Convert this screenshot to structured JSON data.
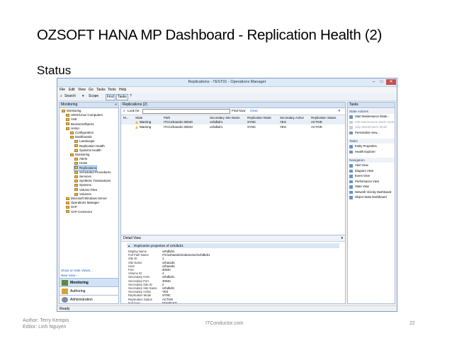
{
  "slide": {
    "title": "OZSOFT HANA MP Dashboard - Replication Health (2)",
    "subtitle": "Status",
    "footer_left_1": "Author: Terry Kempis",
    "footer_left_2": "Editor: Linh Nguyen",
    "footer_center": "ITConductor.com",
    "footer_right": "22"
  },
  "window": {
    "title": "Replications - TEST01 - Operations Manager",
    "min": "–",
    "max": "□",
    "close": "✕",
    "menu": [
      "File",
      "Edit",
      "View",
      "Go",
      "Tasks",
      "Tools",
      "Help"
    ],
    "toolbar": {
      "search": "Search",
      "scope": "Scope",
      "find": "Find",
      "tasks": "Tasks",
      "help": "?"
    },
    "status_bar": "Ready"
  },
  "nav": {
    "header": "Monitoring",
    "tree": [
      {
        "label": "Monitoring",
        "indent": 0
      },
      {
        "label": "UNIX/Linux Computers",
        "indent": 1
      },
      {
        "label": "ASE",
        "indent": 1
      },
      {
        "label": "BusinessObjects",
        "indent": 1
      },
      {
        "label": "HANA",
        "indent": 1
      },
      {
        "label": "Configuration",
        "indent": 2
      },
      {
        "label": "Dashboards",
        "indent": 2
      },
      {
        "label": "Landscape",
        "indent": 3
      },
      {
        "label": "Replication Health",
        "indent": 3
      },
      {
        "label": "Systems Health",
        "indent": 3
      },
      {
        "label": "Monitoring",
        "indent": 2
      },
      {
        "label": "Alerts",
        "indent": 3
      },
      {
        "label": "Hosts",
        "indent": 3
      },
      {
        "label": "Replications",
        "indent": 3,
        "selected": true
      },
      {
        "label": "Scheduled Procedures",
        "indent": 3
      },
      {
        "label": "Services",
        "indent": 3
      },
      {
        "label": "Synthetic Transactions",
        "indent": 3
      },
      {
        "label": "Systems",
        "indent": 3
      },
      {
        "label": "Volume Files",
        "indent": 3
      },
      {
        "label": "Volumes",
        "indent": 3
      },
      {
        "label": "Microsoft Windows Server",
        "indent": 1
      },
      {
        "label": "Operations Manager",
        "indent": 1
      },
      {
        "label": "SAP",
        "indent": 1
      },
      {
        "label": "SAP Connector",
        "indent": 1
      }
    ],
    "show_hide": "Show or Hide Views...",
    "new_view": "New View ›",
    "wunderbar": [
      "Monitoring",
      "Authoring",
      "Administration"
    ]
  },
  "center": {
    "header": "Replications (2)",
    "look_for": "Look for:",
    "find_now": "Find Now",
    "clear": "Clear",
    "columns": [
      "M...",
      "State",
      "Path",
      "Secondary Site Name",
      "Replication Mode",
      "Secondary Active",
      "Replication Status"
    ],
    "rows": [
      {
        "state": "Warning",
        "path": "ITC/ozhanalrc:30040",
        "site": "ozhdbdr1",
        "mode": "SYNC",
        "active": "YES",
        "status": "ACTIVE"
      },
      {
        "state": "Warning",
        "path": "ITC/ozhanalrc:30043",
        "site": "ozhdbdr1",
        "mode": "SYNC",
        "active": "YES",
        "status": "ACTIVE"
      }
    ],
    "detail_header": "Detail View",
    "detail_title": "Replication properties of ozhdbdr1",
    "properties": [
      {
        "k": "Display Name",
        "v": "ozhdbdr1"
      },
      {
        "k": "Full Path Name",
        "v": "ITC/ozhanalrc/indexserver\\ozhdbdr1",
        "link": true
      },
      {
        "k": "Site ID",
        "v": "1"
      },
      {
        "k": "Site Name",
        "v": "ozhanalrc"
      },
      {
        "k": "Host",
        "v": "ozhanalrc"
      },
      {
        "k": "Port",
        "v": "30040"
      },
      {
        "k": "Volume ID",
        "v": "4"
      },
      {
        "k": "Secondary Host",
        "v": "ozhdbdr1"
      },
      {
        "k": "Secondary Port",
        "v": "30040"
      },
      {
        "k": "Secondary Site ID",
        "v": "2"
      },
      {
        "k": "Secondary Site Name",
        "v": "ozhdbdr1"
      },
      {
        "k": "Secondary Active",
        "v": "YES"
      },
      {
        "k": "Replication Mode",
        "v": "SYNC"
      },
      {
        "k": "Replication Status",
        "v": "ACTIVE"
      },
      {
        "k": "Full Sync",
        "v": "DISABLED"
      }
    ]
  },
  "tasks": {
    "header": "Tasks",
    "sections": [
      {
        "title": "State Actions",
        "items": [
          {
            "label": "Start Maintenance Mode...",
            "disabled": false
          },
          {
            "label": "Edit Maintenance Mode Settings...",
            "disabled": true
          },
          {
            "label": "Stop Maintenance Mode",
            "disabled": true
          },
          {
            "label": "Personalize view...",
            "disabled": false
          }
        ]
      },
      {
        "title": "Tasks",
        "items": [
          {
            "label": "Entity Properties",
            "disabled": false
          },
          {
            "label": "Health Explorer",
            "disabled": false
          }
        ]
      },
      {
        "title": "Navigation",
        "items": [
          {
            "label": "Alert View",
            "disabled": false
          },
          {
            "label": "Diagram View",
            "disabled": false
          },
          {
            "label": "Event View",
            "disabled": false
          },
          {
            "label": "Performance View",
            "disabled": false
          },
          {
            "label": "State View",
            "disabled": false
          },
          {
            "label": "Network Vicinity Dashboard",
            "disabled": false
          },
          {
            "label": "Object State Dashboard",
            "disabled": false
          }
        ]
      }
    ]
  },
  "colors": {
    "accent": "#1b5fb3",
    "warning": "#e9b81f",
    "selection": "#cde4fa"
  }
}
